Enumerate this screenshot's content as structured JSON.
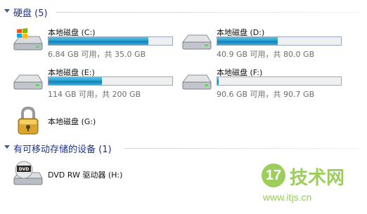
{
  "groups": [
    {
      "title": "硬盘 (5)"
    },
    {
      "title": "有可移动存储的设备 (1)"
    }
  ],
  "drives": [
    {
      "name": "本地磁盘 (C:)",
      "info": "6.84 GB 可用，共 35.0 GB",
      "used_fraction": 0.805,
      "icon": "windows-drive-icon"
    },
    {
      "name": "本地磁盘 (D:)",
      "info": "40.9 GB 可用，共 80.0 GB",
      "used_fraction": 0.49,
      "icon": "hard-drive-icon"
    },
    {
      "name": "本地磁盘 (E:)",
      "info": "114 GB 可用，共 200 GB",
      "used_fraction": 0.43,
      "icon": "hard-drive-icon"
    },
    {
      "name": "本地磁盘 (F:)",
      "info": "90.6 GB 可用，共 90.7 GB",
      "used_fraction": 0.01,
      "icon": "hard-drive-icon"
    },
    {
      "name": "本地磁盘 (G:)",
      "icon": "locked-drive-icon"
    }
  ],
  "removable": [
    {
      "name": "DVD RW 驱动器 (H:)",
      "icon": "dvd-drive-icon",
      "badge": "DVD"
    }
  ],
  "watermark": {
    "logo_number": "17",
    "logo_text": "技术网",
    "url": "www.itjs.cn"
  },
  "colors": {
    "header_text": "#1e3287",
    "bar_fill": "#26a0d0",
    "watermark": "#8cc63f"
  }
}
